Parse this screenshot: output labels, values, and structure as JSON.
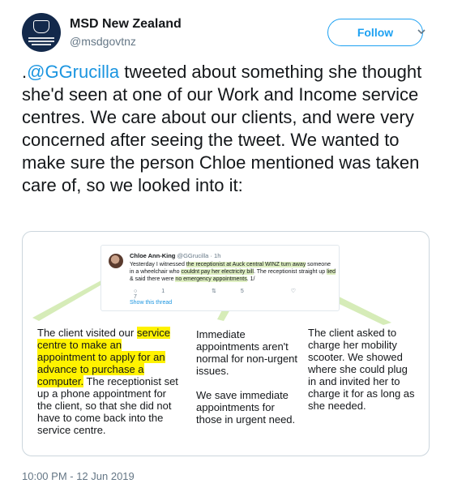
{
  "account": {
    "name": "MSD New Zealand",
    "handle": "@msdgovtnz",
    "follow_label": "Follow",
    "avatar_icon": "msd-crest-logo"
  },
  "tweet": {
    "prefix": ".",
    "mention": "@GGrucilla",
    "text_rest": " tweeted about something she thought she'd seen at one of our Work and Income service centres. We care about our clients, and were very concerned after seeing the tweet. We wanted to make sure the person Chloe mentioned was taken care of, so we looked into it:",
    "timestamp": "10:00 PM - 12 Jun 2019"
  },
  "embedded_tweet": {
    "name": "Chloe Ann-King",
    "handle_time": "@GGrucilla · 1h",
    "segments": [
      "Yesterday I witnessed ",
      "the receptionist at Auck central WINZ turn away",
      " someone in a wheelchair who ",
      "couldnt pay her electricity bill",
      ". The receptionist straight up ",
      "lied",
      " & said there were ",
      "no emergency appointments",
      ". 1/"
    ],
    "reply_count": "1",
    "retweet_count": "5",
    "like_count": "7",
    "show_thread": "Show this thread"
  },
  "annotations": {
    "col1_pre": "The client visited our ",
    "col1_highlight": "service centre to make an appointment to apply for an advance to purchase a computer.",
    "col1_post": " The receptionist set up a phone appointment for the client, so that she did not have to come back into the service centre.",
    "col2_p1": "Immediate appointments aren't normal for non-urgent issues.",
    "col2_p2": "We save immediate appointments for those in urgent need.",
    "col3": "The client asked to charge her mobility scooter. We showed where she could plug in and invited her to charge it for as long as she needed."
  },
  "colors": {
    "accent": "#1da1f2",
    "link": "#1b95e0",
    "highlight_yellow": "#fff200",
    "highlight_green": "#dff0c2",
    "connector_green": "#c8e6a0"
  }
}
